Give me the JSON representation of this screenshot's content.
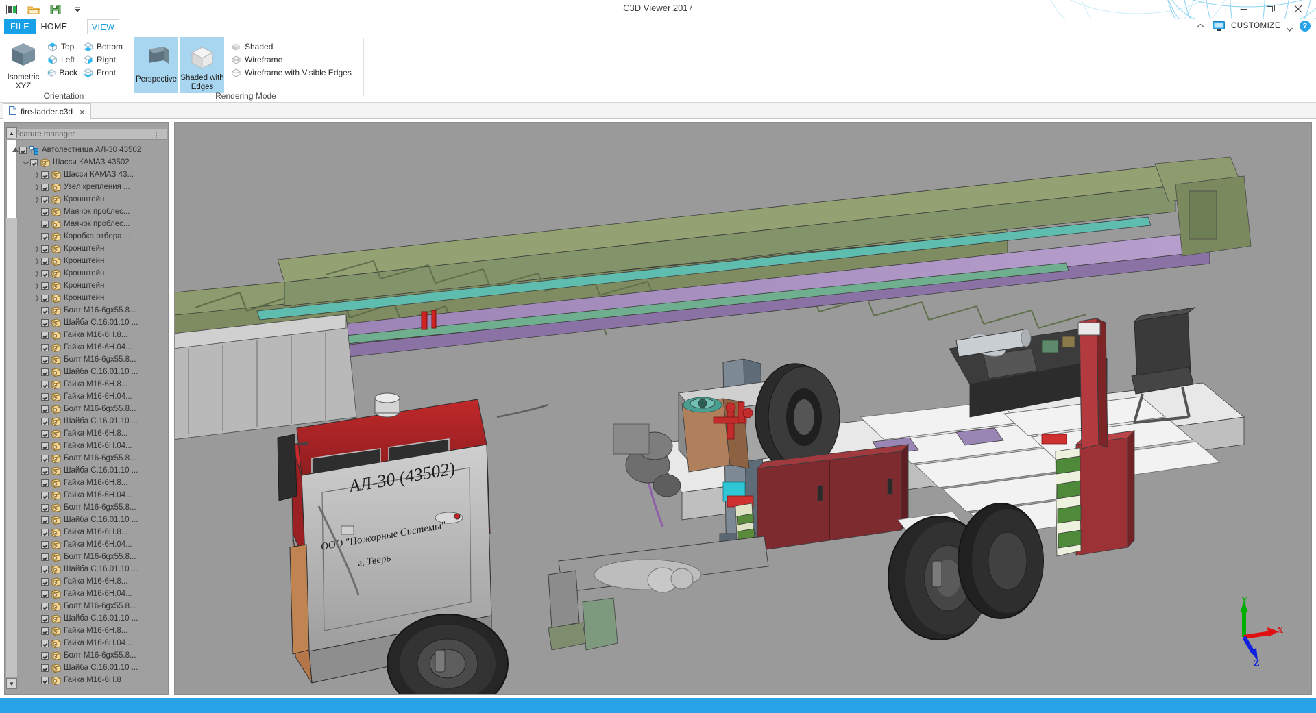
{
  "window": {
    "title": "C3D Viewer 2017",
    "minimize_label": "minimize",
    "maximize_label": "restore",
    "close_label": "close"
  },
  "quick_access": {
    "items": [
      {
        "name": "app-icon",
        "label": "App"
      },
      {
        "name": "open-icon",
        "label": "Open"
      },
      {
        "name": "save-icon",
        "label": "Save"
      },
      {
        "name": "qat-dropdown-icon",
        "label": "Customize Quick Access Toolbar"
      }
    ]
  },
  "ribbon": {
    "tabs": [
      {
        "id": "file",
        "label": "FILE",
        "active": false
      },
      {
        "id": "home",
        "label": "HOME",
        "active": false
      },
      {
        "id": "view",
        "label": "VIEW",
        "active": true
      }
    ],
    "groups": [
      {
        "id": "orientation",
        "label": "Orientation",
        "big_button": {
          "line1": "Isometric",
          "line2": "XYZ"
        },
        "small_buttons": [
          {
            "label": "Top"
          },
          {
            "label": "Bottom"
          },
          {
            "label": "Left"
          },
          {
            "label": "Right"
          },
          {
            "label": "Back"
          },
          {
            "label": "Front"
          }
        ]
      },
      {
        "id": "rendering-mode",
        "label": "Rendering Mode",
        "mode_buttons": [
          {
            "label": "Perspective",
            "active": true
          },
          {
            "label": "Shaded with Edges",
            "active": true
          }
        ],
        "small_buttons": [
          {
            "label": "Shaded"
          },
          {
            "label": "Wireframe"
          },
          {
            "label": "Wireframe with Visible Edges"
          }
        ]
      }
    ]
  },
  "top_right": {
    "collapse_label": "collapse-ribbon",
    "display_label": "display",
    "customize_label": "CUSTOMIZE",
    "help_label": "?"
  },
  "document_tabs": [
    {
      "label": "fire-ladder.c3d",
      "close": "×",
      "active": true
    }
  ],
  "feature_manager": {
    "search_placeholder": "Feature manager",
    "scroll_up": "▲",
    "scroll_down": "▼",
    "tree": [
      {
        "depth": 0,
        "arrow": "up",
        "label": "Автолестница АЛ-30 43502",
        "icon": "assembly-root-icon"
      },
      {
        "depth": 1,
        "arrow": "down",
        "label": "Шасси КАМАЗ 43502",
        "icon": "part-icon"
      },
      {
        "depth": 2,
        "arrow": "right",
        "label": "Шасси КАМАЗ 43...",
        "icon": "part-icon"
      },
      {
        "depth": 2,
        "arrow": "right",
        "label": "Узел крепления ...",
        "icon": "part-icon"
      },
      {
        "depth": 2,
        "arrow": "right",
        "label": "Кронштейн",
        "icon": "part-icon"
      },
      {
        "depth": 2,
        "arrow": "none",
        "label": "Маячок проблес...",
        "icon": "part-icon"
      },
      {
        "depth": 2,
        "arrow": "none",
        "label": "Маячок проблес...",
        "icon": "part-icon"
      },
      {
        "depth": 2,
        "arrow": "none",
        "label": "Коробка отбора ...",
        "icon": "part-icon"
      },
      {
        "depth": 2,
        "arrow": "right",
        "label": "Кронштейн",
        "icon": "part-icon"
      },
      {
        "depth": 2,
        "arrow": "right",
        "label": "Кронштейн",
        "icon": "part-icon"
      },
      {
        "depth": 2,
        "arrow": "right",
        "label": "Кронштейн",
        "icon": "part-icon"
      },
      {
        "depth": 2,
        "arrow": "right",
        "label": "Кронштейн",
        "icon": "part-icon"
      },
      {
        "depth": 2,
        "arrow": "right",
        "label": "Кронштейн",
        "icon": "part-icon"
      },
      {
        "depth": 2,
        "arrow": "none",
        "label": "Болт M16-6gx55.8...",
        "icon": "part-icon"
      },
      {
        "depth": 2,
        "arrow": "none",
        "label": "Шайба С.16.01.10 ...",
        "icon": "part-icon"
      },
      {
        "depth": 2,
        "arrow": "none",
        "label": "Гайка  M16-6H.8...",
        "icon": "part-icon"
      },
      {
        "depth": 2,
        "arrow": "none",
        "label": "Гайка  M16-6H.04...",
        "icon": "part-icon"
      },
      {
        "depth": 2,
        "arrow": "none",
        "label": "Болт M16-6gx55.8...",
        "icon": "part-icon"
      },
      {
        "depth": 2,
        "arrow": "none",
        "label": "Шайба С.16.01.10 ...",
        "icon": "part-icon"
      },
      {
        "depth": 2,
        "arrow": "none",
        "label": "Гайка  M16-6H.8...",
        "icon": "part-icon"
      },
      {
        "depth": 2,
        "arrow": "none",
        "label": "Гайка  M16-6H.04...",
        "icon": "part-icon"
      },
      {
        "depth": 2,
        "arrow": "none",
        "label": "Болт M16-6gx55.8...",
        "icon": "part-icon"
      },
      {
        "depth": 2,
        "arrow": "none",
        "label": "Шайба С.16.01.10 ...",
        "icon": "part-icon"
      },
      {
        "depth": 2,
        "arrow": "none",
        "label": "Гайка  M16-6H.8...",
        "icon": "part-icon"
      },
      {
        "depth": 2,
        "arrow": "none",
        "label": "Гайка  M16-6H.04...",
        "icon": "part-icon"
      },
      {
        "depth": 2,
        "arrow": "none",
        "label": "Болт M16-6gx55.8...",
        "icon": "part-icon"
      },
      {
        "depth": 2,
        "arrow": "none",
        "label": "Шайба С.16.01.10 ...",
        "icon": "part-icon"
      },
      {
        "depth": 2,
        "arrow": "none",
        "label": "Гайка  M16-6H.8...",
        "icon": "part-icon"
      },
      {
        "depth": 2,
        "arrow": "none",
        "label": "Гайка  M16-6H.04...",
        "icon": "part-icon"
      },
      {
        "depth": 2,
        "arrow": "none",
        "label": "Болт M16-6gx55.8...",
        "icon": "part-icon"
      },
      {
        "depth": 2,
        "arrow": "none",
        "label": "Шайба С.16.01.10 ...",
        "icon": "part-icon"
      },
      {
        "depth": 2,
        "arrow": "none",
        "label": "Гайка  M16-6H.8...",
        "icon": "part-icon"
      },
      {
        "depth": 2,
        "arrow": "none",
        "label": "Гайка  M16-6H.04...",
        "icon": "part-icon"
      },
      {
        "depth": 2,
        "arrow": "none",
        "label": "Болт M16-6gx55.8...",
        "icon": "part-icon"
      },
      {
        "depth": 2,
        "arrow": "none",
        "label": "Шайба С.16.01.10 ...",
        "icon": "part-icon"
      },
      {
        "depth": 2,
        "arrow": "none",
        "label": "Гайка  M16-6H.8...",
        "icon": "part-icon"
      },
      {
        "depth": 2,
        "arrow": "none",
        "label": "Гайка  M16-6H.04...",
        "icon": "part-icon"
      },
      {
        "depth": 2,
        "arrow": "none",
        "label": "Болт M16-6gx55.8...",
        "icon": "part-icon"
      },
      {
        "depth": 2,
        "arrow": "none",
        "label": "Шайба С.16.01.10 ...",
        "icon": "part-icon"
      },
      {
        "depth": 2,
        "arrow": "none",
        "label": "Гайка  M16-6H.8...",
        "icon": "part-icon"
      },
      {
        "depth": 2,
        "arrow": "none",
        "label": "Гайка  M16-6H.04...",
        "icon": "part-icon"
      },
      {
        "depth": 2,
        "arrow": "none",
        "label": "Болт M16-6gx55.8...",
        "icon": "part-icon"
      },
      {
        "depth": 2,
        "arrow": "none",
        "label": "Шайба С.16.01.10 ...",
        "icon": "part-icon"
      },
      {
        "depth": 2,
        "arrow": "none",
        "label": "Гайка  M16-6H.8",
        "icon": "part-icon"
      }
    ]
  },
  "viewport": {
    "background_color": "#9a9a9a",
    "axis_labels": {
      "x": "X",
      "y": "Y",
      "z": "Z"
    },
    "axis_colors": {
      "x": "#e01010",
      "y": "#00b000",
      "z": "#1020e0"
    },
    "model_decals": {
      "line1": "АЛ-30 (43502)",
      "line2": "ООО \"Пожарные Системы\"",
      "line3": "г. Тверь"
    }
  },
  "colors": {
    "accent": "#29a3e8",
    "ribbon_highlight": "#a8d5ef",
    "panel_bg": "#a0a0a0",
    "viewport_bg": "#9a9a9a"
  }
}
